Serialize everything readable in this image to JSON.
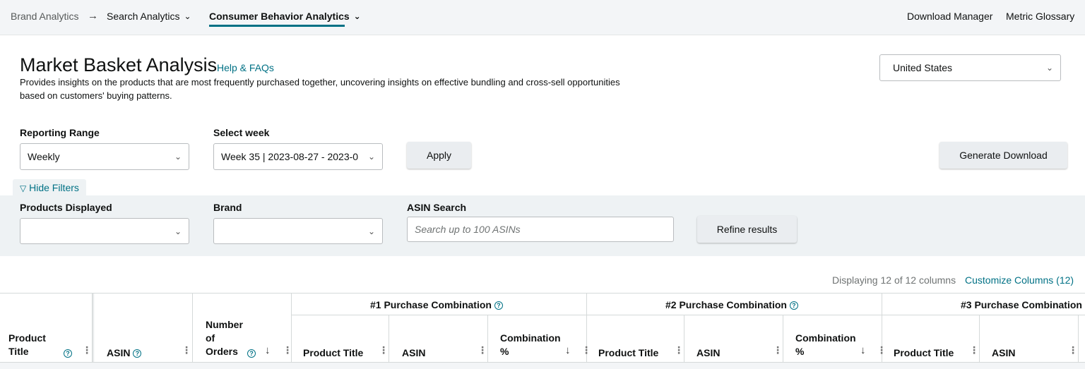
{
  "nav": {
    "brand_analytics": "Brand Analytics",
    "search_analytics": "Search Analytics",
    "consumer_behavior": "Consumer Behavior Analytics",
    "download_manager": "Download Manager",
    "metric_glossary": "Metric Glossary"
  },
  "header": {
    "title": "Market Basket Analysis",
    "help_link": "Help & FAQs",
    "description": "Provides insights on the products that are most frequently purchased together, uncovering insights on effective bundling and cross-sell opportunities based on customers' buying patterns.",
    "country_selected": "United States"
  },
  "controls": {
    "reporting_range_label": "Reporting Range",
    "reporting_range_value": "Weekly",
    "select_week_label": "Select week",
    "select_week_value": "Week 35 | 2023-08-27 - 2023-0",
    "apply_label": "Apply",
    "generate_download_label": "Generate Download"
  },
  "filters": {
    "hide_filters_label": "Hide Filters",
    "products_displayed_label": "Products Displayed",
    "brand_label": "Brand",
    "asin_search_label": "ASIN Search",
    "asin_search_placeholder": "Search up to 100 ASINs",
    "refine_label": "Refine results"
  },
  "table": {
    "displaying_text": "Displaying 12 of 12 columns",
    "customize_columns": "Customize Columns (12)",
    "groups": [
      "#1 Purchase Combination",
      "#2 Purchase Combination",
      "#3 Purchase Combination"
    ],
    "columns": {
      "product_title_line1": "Product",
      "product_title_line2": "Title",
      "asin": "ASIN",
      "orders_line1": "Number",
      "orders_line2": "of",
      "orders_line3": "Orders",
      "sub_product_title": "Product Title",
      "sub_asin": "ASIN",
      "combination_line1": "Combination",
      "combination_line2": "%"
    }
  },
  "colors": {
    "link": "#007185",
    "nav_bg": "#f3f5f7",
    "filter_bg": "#eef2f4",
    "button_bg": "#eaedf0"
  }
}
